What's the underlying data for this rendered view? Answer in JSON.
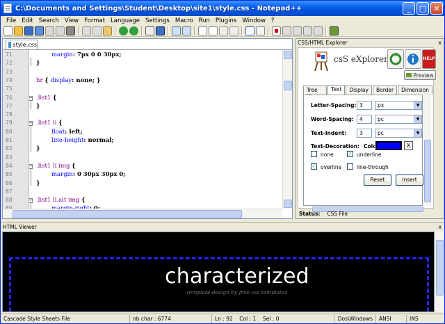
{
  "window": {
    "title": "C:\\Documents and Settings\\Student\\Desktop\\site1\\style.css - Notepad++",
    "min": "_",
    "max": "□",
    "close": "✕"
  },
  "menu": [
    "File",
    "Edit",
    "Search",
    "View",
    "Format",
    "Language",
    "Settings",
    "Macro",
    "Run",
    "Plugins",
    "Window",
    "?"
  ],
  "editor": {
    "tab": "style.css",
    "lines": [
      {
        "n": "71",
        "indent": 2,
        "parts": [
          [
            "prop",
            "margin"
          ],
          [
            "brc",
            ": "
          ],
          [
            "val",
            "7px 0 0 30px;"
          ]
        ]
      },
      {
        "n": "72",
        "indent": 0,
        "parts": [
          [
            "brc",
            "}"
          ]
        ]
      },
      {
        "n": "73",
        "indent": 0,
        "parts": []
      },
      {
        "n": "74",
        "indent": 0,
        "parts": [
          [
            "sel",
            "hr "
          ],
          [
            "brc",
            "{ "
          ],
          [
            "prop",
            "display"
          ],
          [
            "brc",
            ": "
          ],
          [
            "val",
            "none; }"
          ]
        ]
      },
      {
        "n": "75",
        "indent": 0,
        "parts": []
      },
      {
        "n": "76",
        "indent": 0,
        "fold": true,
        "parts": [
          [
            "sel",
            ".list1 "
          ],
          [
            "brc",
            "{"
          ]
        ]
      },
      {
        "n": "77",
        "indent": 0,
        "parts": [
          [
            "brc",
            "}"
          ]
        ]
      },
      {
        "n": "78",
        "indent": 0,
        "parts": []
      },
      {
        "n": "79",
        "indent": 0,
        "fold": true,
        "parts": [
          [
            "sel",
            ".list1 li "
          ],
          [
            "brc",
            "{"
          ]
        ]
      },
      {
        "n": "80",
        "indent": 2,
        "parts": [
          [
            "prop",
            "float"
          ],
          [
            "brc",
            ": "
          ],
          [
            "val",
            "left;"
          ]
        ]
      },
      {
        "n": "81",
        "indent": 2,
        "parts": [
          [
            "prop",
            "line-height"
          ],
          [
            "brc",
            ": "
          ],
          [
            "val",
            "normal;"
          ]
        ]
      },
      {
        "n": "82",
        "indent": 0,
        "parts": [
          [
            "brc",
            "}"
          ]
        ]
      },
      {
        "n": "83",
        "indent": 0,
        "parts": []
      },
      {
        "n": "84",
        "indent": 0,
        "fold": true,
        "parts": [
          [
            "sel",
            ".list1 li img "
          ],
          [
            "brc",
            "{"
          ]
        ]
      },
      {
        "n": "85",
        "indent": 2,
        "parts": [
          [
            "prop",
            "margin"
          ],
          [
            "brc",
            ": "
          ],
          [
            "val",
            "0 30px 30px 0;"
          ]
        ]
      },
      {
        "n": "86",
        "indent": 0,
        "parts": [
          [
            "brc",
            "}"
          ]
        ]
      },
      {
        "n": "87",
        "indent": 0,
        "parts": []
      },
      {
        "n": "88",
        "indent": 0,
        "fold": true,
        "parts": [
          [
            "sel",
            ".list1 li.alt img "
          ],
          [
            "brc",
            "{"
          ]
        ]
      },
      {
        "n": "89",
        "indent": 2,
        "parts": [
          [
            "prop",
            "margin-right"
          ],
          [
            "brc",
            ": "
          ],
          [
            "val",
            "0;"
          ]
        ]
      }
    ]
  },
  "panel": {
    "header": "CSS/HTML Explorer",
    "close": "x",
    "logo_text": "csS eXplorer",
    "help_label": "HELP",
    "preview": "Preview",
    "tabs": [
      "Tree View",
      "Text",
      "Display",
      "Border",
      "Dimension"
    ],
    "active_tab": "Text",
    "fields": [
      {
        "label": "Letter-Spacing:",
        "value": "3",
        "unit": "px"
      },
      {
        "label": "Word-Spacing:",
        "value": "4",
        "unit": "pc"
      },
      {
        "label": "Text-Indent:",
        "value": "3",
        "unit": "pc"
      }
    ],
    "decoration_label": "Text-Decoration:",
    "color_label": "Color:",
    "color_value": "#0000ff",
    "color_clear": "X",
    "checks": [
      {
        "label": "none",
        "checked": false
      },
      {
        "label": "underline",
        "checked": true
      },
      {
        "label": "overline",
        "checked": true
      },
      {
        "label": "line-through",
        "checked": false
      }
    ],
    "reset": "Reset",
    "insert": "Insert",
    "status_label": "Status:",
    "status_value": "CSS File"
  },
  "viewer": {
    "header": "HTML Viewer",
    "close": "x",
    "headline": "characterized",
    "tagline": "template design by free css templates"
  },
  "statusbar": {
    "filetype": "Cascade Style Sheets File",
    "chars": "nb char : 6774",
    "pos": "Ln : 92    Col : 1    Sel : 0",
    "eol": "Dos\\Windows",
    "enc": "ANSI",
    "mode": "INS"
  }
}
